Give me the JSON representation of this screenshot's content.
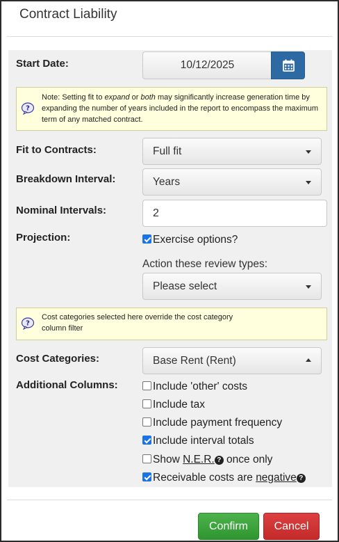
{
  "dialog": {
    "title": "Contract Liability"
  },
  "start_date": {
    "label": "Start Date:",
    "value": "10/12/2025",
    "icon": "calendar-icon"
  },
  "note_fit": {
    "prefix": "Note: Setting fit to ",
    "em1": "expand",
    "mid": " or ",
    "em2": "both",
    "suffix": " may significantly increase generation time by expanding the number of years included in the report to encompass the maximum term of any matched contract."
  },
  "fit_to_contracts": {
    "label": "Fit to Contracts:",
    "value": "Full fit"
  },
  "breakdown_interval": {
    "label": "Breakdown Interval:",
    "value": "Years"
  },
  "nominal_intervals": {
    "label": "Nominal Intervals:",
    "value": "2"
  },
  "projection": {
    "label": "Projection:",
    "exercise_options": {
      "label": "Exercise options?",
      "checked": true
    },
    "review_types_label": "Action these review types:",
    "review_types_value": "Please select"
  },
  "note_cost": {
    "text": "Cost categories selected here override the cost category column filter"
  },
  "cost_categories": {
    "label": "Cost Categories:",
    "value": "Base Rent (Rent)"
  },
  "additional_columns": {
    "label": "Additional Columns:",
    "items": [
      {
        "label": "Include 'other' costs",
        "checked": false
      },
      {
        "label": "Include tax",
        "checked": false
      },
      {
        "label": "Include payment frequency",
        "checked": false
      },
      {
        "label": "Include interval totals",
        "checked": true
      }
    ],
    "show_ner": {
      "prefix": "Show ",
      "link": "N.E.R.",
      "suffix": " once only",
      "checked": false
    },
    "receivable": {
      "prefix": "Receivable costs are ",
      "link": "negative",
      "checked": true
    }
  },
  "footer": {
    "confirm": "Confirm",
    "cancel": "Cancel"
  },
  "colors": {
    "primary": "#2d6aa3",
    "confirm": "#3aa63a",
    "cancel": "#d33333",
    "note_bg": "#ffffdd",
    "checkbox": "#1a73e8"
  }
}
